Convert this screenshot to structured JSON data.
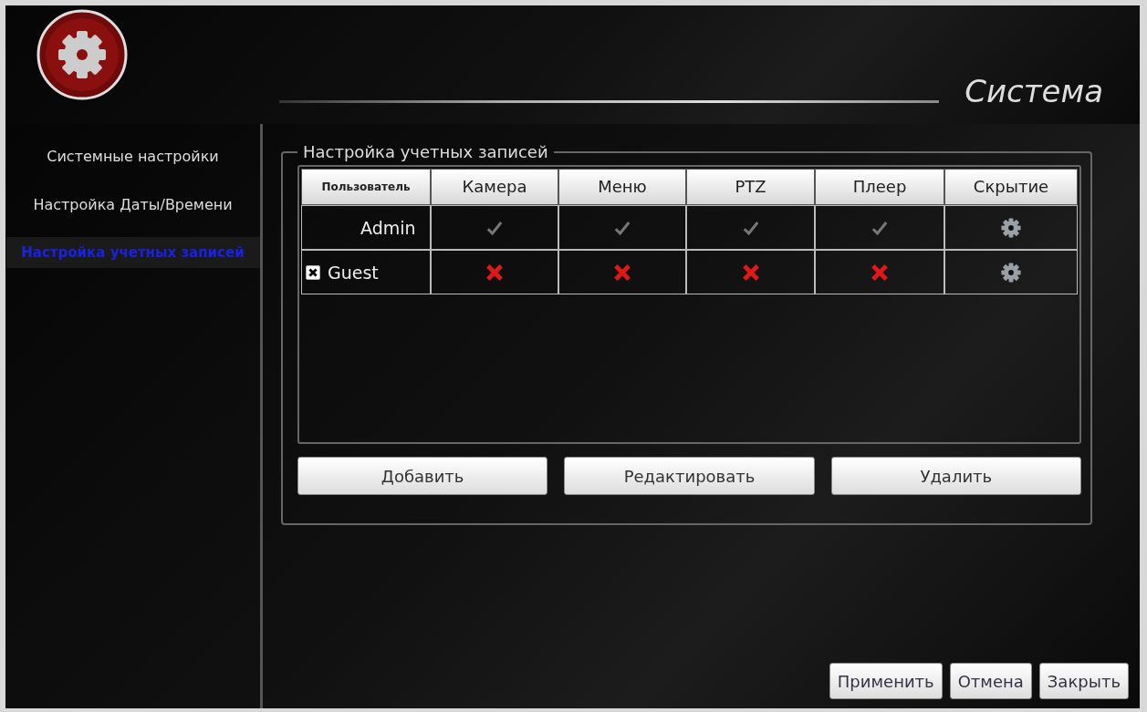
{
  "window": {
    "title": "Система"
  },
  "sidebar": {
    "items": [
      {
        "label": "Системные настройки",
        "selected": false
      },
      {
        "label": "Настройка Даты/Времени",
        "selected": false
      },
      {
        "label": "Настройка учетных записей",
        "selected": true
      }
    ]
  },
  "accounts": {
    "title": "Настройка учетных записей",
    "columns": [
      "Пользователь",
      "Камера",
      "Меню",
      "PTZ",
      "Плеер",
      "Скрытие"
    ],
    "rows": [
      {
        "user": "Admin",
        "permissions": [
          true,
          true,
          true,
          true
        ]
      },
      {
        "user": "Guest",
        "checked": true,
        "permissions": [
          false,
          false,
          false,
          false
        ]
      }
    ],
    "buttons": [
      "Добавить",
      "Редактировать",
      "Удалить"
    ]
  },
  "footer_buttons": [
    "Применить",
    "Отмена",
    "Закрыть"
  ]
}
